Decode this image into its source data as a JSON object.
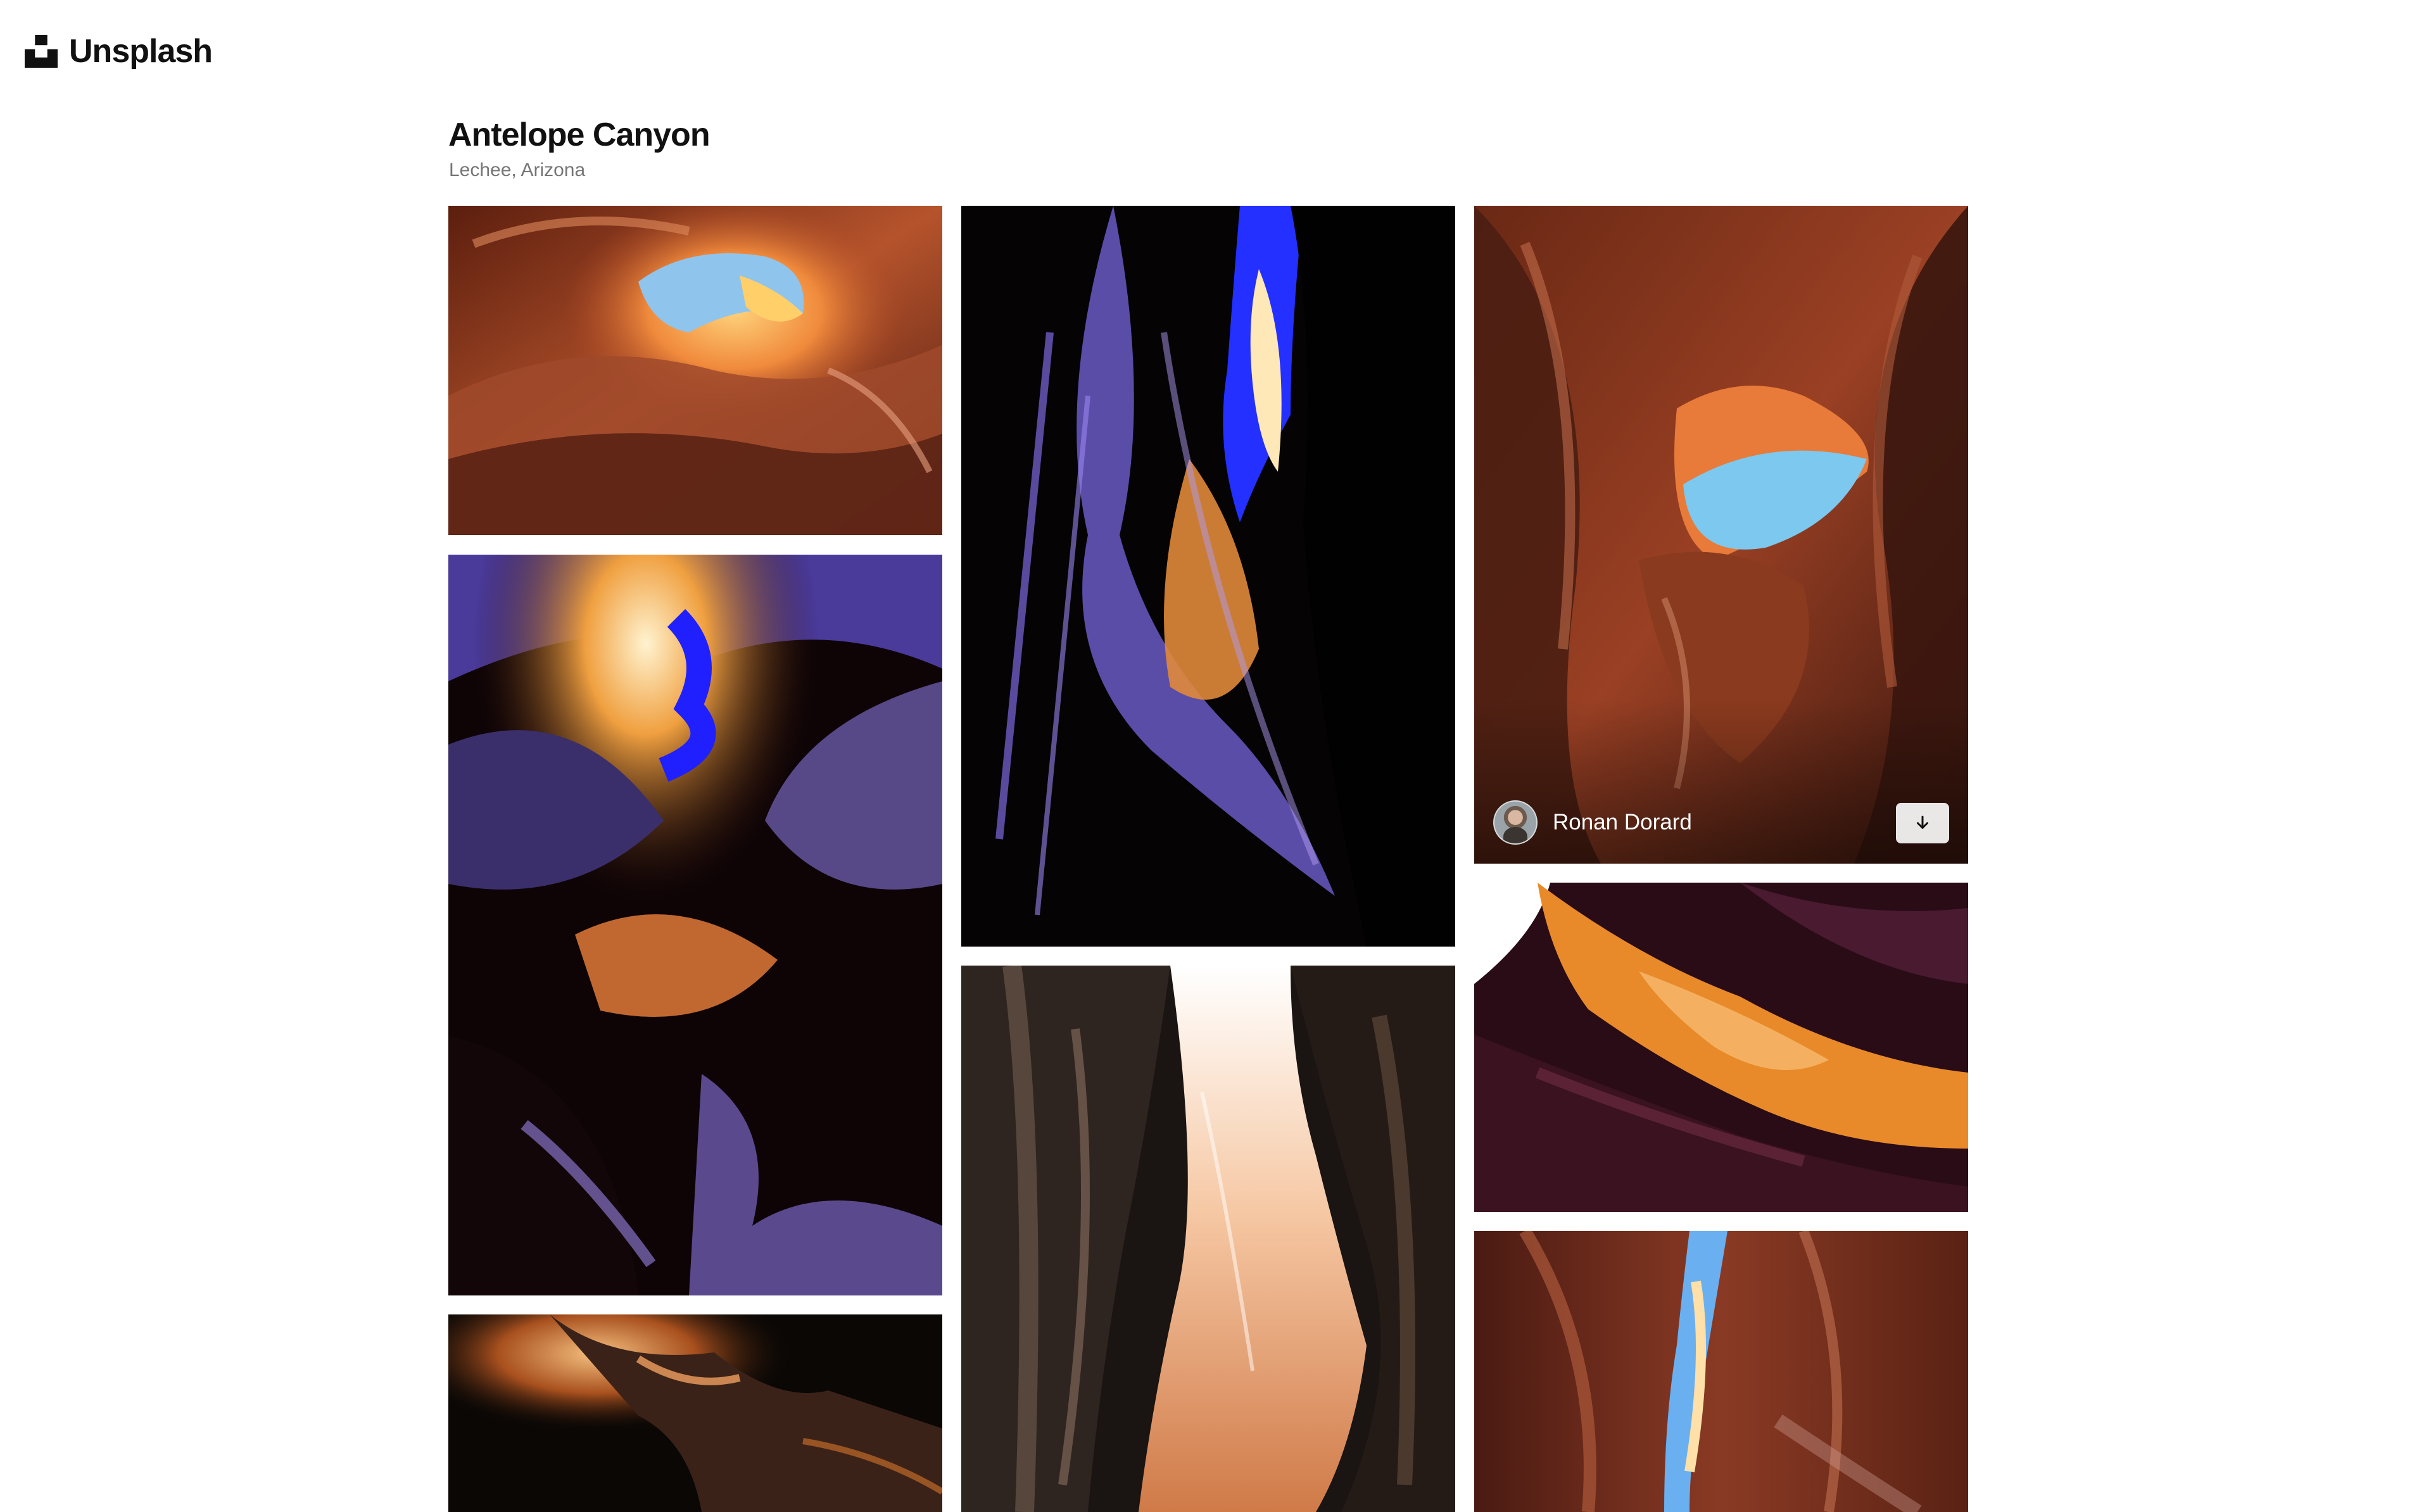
{
  "header": {
    "brand_name": "Unsplash",
    "logo_icon": "unsplash-logo-icon"
  },
  "location": {
    "title": "Antelope Canyon",
    "subtitle": "Lechee, Arizona"
  },
  "photos": [
    {
      "id": "photo-1",
      "alt": "Antelope Canyon curved sandstone with blue sky opening",
      "palette": [
        "#7a3018",
        "#c8643a",
        "#f2a45a",
        "#8fc4ec"
      ]
    },
    {
      "id": "photo-2",
      "alt": "Antelope Canyon purple light streaks in dark slot",
      "palette": [
        "#050304",
        "#6b5cc4",
        "#e38a3a",
        "#2a2dff"
      ]
    },
    {
      "id": "photo-3",
      "alt": "Antelope Canyon swirling rock walls with blue opening",
      "palette": [
        "#4a1e12",
        "#b0532c",
        "#e2733e",
        "#7cc8ee"
      ],
      "hover": true
    },
    {
      "id": "photo-4",
      "alt": "Antelope Canyon glowing amber light beam",
      "palette": [
        "#140406",
        "#5a2a66",
        "#e07a20",
        "#fff3dc"
      ]
    },
    {
      "id": "photo-5",
      "alt": "Antelope Canyon orange and dark waves",
      "palette": [
        "#1e0b10",
        "#4b1a28",
        "#ef8a2a",
        "#ffffff"
      ]
    },
    {
      "id": "photo-6",
      "alt": "Antelope Canyon narrow bright slot",
      "palette": [
        "#1b1512",
        "#5c4638",
        "#eeaa7c",
        "#ffffff"
      ]
    },
    {
      "id": "photo-7",
      "alt": "Antelope Canyon dark chamber with orange glow",
      "palette": [
        "#0c0806",
        "#2a1a14",
        "#c26a2a",
        "#f5c080"
      ]
    },
    {
      "id": "photo-8",
      "alt": "Antelope Canyon red walls with blue slit",
      "palette": [
        "#3a1410",
        "#8a3a24",
        "#f0a060",
        "#6ab0f0"
      ]
    }
  ],
  "hover_card": {
    "author_name": "Ronan Dorard",
    "avatar_icon": "avatar-icon",
    "download_icon": "download-arrow-icon"
  }
}
